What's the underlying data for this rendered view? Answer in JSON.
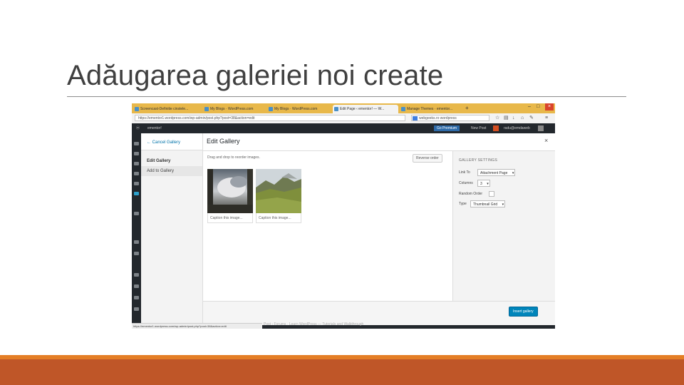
{
  "slide": {
    "title": "Adăugarea galeriei noi create"
  },
  "browser": {
    "tabs": [
      {
        "label": "Screencast-Definitie cinstele..."
      },
      {
        "label": "My Blogs · WordPress.com"
      },
      {
        "label": "My Blogs · WordPress.com"
      },
      {
        "label": "Edit Page ‹ ementor! — W..."
      },
      {
        "label": "Manage Themes · ementor..."
      }
    ],
    "url": "https://ementor1.wordpress.com/wp-admin/post.php?post=38&action=edit",
    "search": "webgeeks.ro wordpress",
    "status_url": "https://ementor1.wordpress.com/wp-admin/post.php?post=38&action=edit"
  },
  "admin_bar": {
    "site": "ementor!",
    "go_premium": "Go Premium",
    "new_post": "New Post",
    "user": "radu@emdaweb"
  },
  "modal": {
    "cancel_label": "← Cancel Gallery",
    "menu": [
      "Edit Gallery",
      "Add to Gallery"
    ],
    "title": "Edit Gallery",
    "close": "×",
    "hint": "Drag and drop to reorder images.",
    "reverse_label": "Reverse order",
    "attachments": [
      {
        "caption": "Caption this image..."
      },
      {
        "caption": "Caption this image..."
      }
    ],
    "settings": {
      "heading": "GALLERY SETTINGS",
      "link_to_label": "Link To",
      "link_to_value": "Attachment Page",
      "columns_label": "Columns",
      "columns_value": "3",
      "random_label": "Random Order",
      "type_label": "Type",
      "type_value": "Thumbnail Grid"
    },
    "insert_label": "Insert gallery"
  },
  "background_text": "Post ‹ Forums · Learn WordPress — Tutorials and Walkthrough"
}
